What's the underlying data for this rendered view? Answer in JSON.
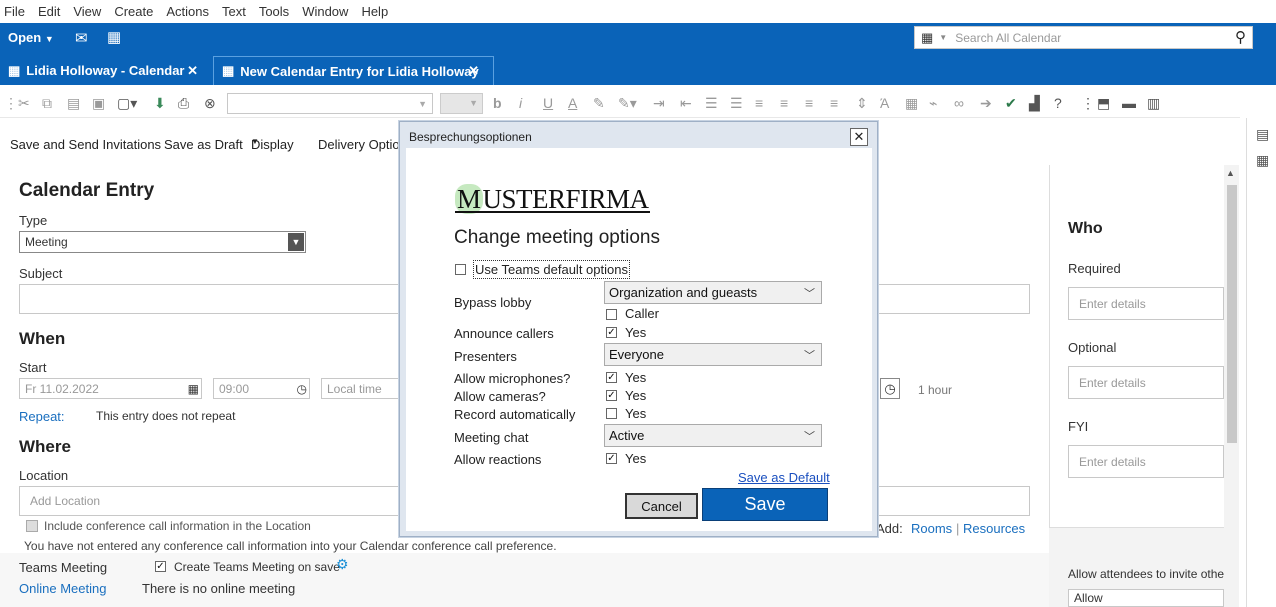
{
  "menu": [
    "File",
    "Edit",
    "View",
    "Create",
    "Actions",
    "Text",
    "Tools",
    "Window",
    "Help"
  ],
  "header": {
    "open_label": "Open",
    "search_placeholder": "Search All Calendar"
  },
  "tabs": [
    {
      "label": "Lidia Holloway - Calendar"
    },
    {
      "label": "New Calendar Entry for Lidia Holloway"
    }
  ],
  "actions": {
    "save_send": "Save and Send Invitations",
    "save_draft": "Save as Draft",
    "display": "Display",
    "delivery": "Delivery Option"
  },
  "form": {
    "title": "Calendar Entry",
    "type_label": "Type",
    "type_value": "Meeting",
    "subject_label": "Subject",
    "when_heading": "When",
    "start_label": "Start",
    "start_date": "Fr 11.02.2022",
    "start_time": "09:00",
    "timezone_placeholder": "Local time",
    "duration": "1 hour",
    "repeat_label": "Repeat:",
    "repeat_value": "This entry does not repeat",
    "where_heading": "Where",
    "location_label": "Location",
    "location_placeholder": "Add Location",
    "include_conf": "Include conference call information in the Location",
    "conf_note": "You have not entered any conference call information into your Calendar conference call preference.",
    "teams_meeting_label": "Teams Meeting",
    "create_teams": "Create Teams Meeting on save",
    "online_meeting_label": "Online Meeting",
    "online_meeting_value": "There is no online meeting",
    "add_label": "Add:",
    "rooms": "Rooms",
    "sep": "|",
    "resources": "Resources"
  },
  "who": {
    "heading": "Who",
    "required_label": "Required",
    "optional_label": "Optional",
    "fyi_label": "FYI",
    "placeholder": "Enter details",
    "allow_invite": "Allow attendees to invite othe",
    "allow_value": "Allow"
  },
  "dialog": {
    "title": "Besprechungsoptionen",
    "close": "✕",
    "logo_first": "M",
    "logo_rest": "USTERFIRMA",
    "heading": "Change meeting options",
    "teams_default": "Use Teams default options",
    "bypass_lobby_label": "Bypass lobby",
    "bypass_lobby_value": "Organization and gueasts",
    "caller_label": "Caller",
    "announce_label": "Announce callers",
    "yes": "Yes",
    "presenters_label": "Presenters",
    "presenters_value": "Everyone",
    "mic_label": "Allow microphones?",
    "cam_label": "Allow cameras?",
    "record_label": "Record automatically",
    "chat_label": "Meeting chat",
    "chat_value": "Active",
    "reactions_label": "Allow reactions",
    "save_default": "Save as Default",
    "cancel": "Cancel",
    "save": "Save"
  }
}
